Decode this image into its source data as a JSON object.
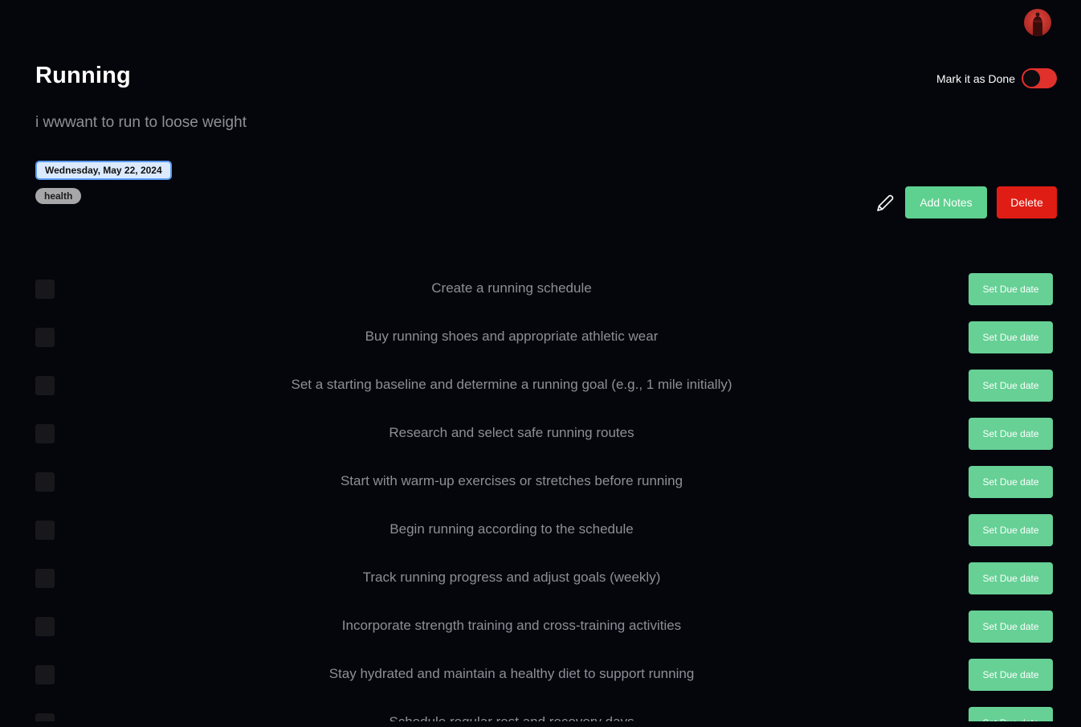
{
  "header": {
    "avatar_icon": "user-avatar-icon"
  },
  "goal": {
    "title": "Running",
    "description": "i wwwant to run to loose weight",
    "date": "Wednesday, May 22, 2024",
    "tag": "health",
    "done_label": "Mark it as Done",
    "done": false
  },
  "actions": {
    "edit_icon": "pencil-icon",
    "add_notes_label": "Add Notes",
    "delete_label": "Delete"
  },
  "tasks": [
    {
      "text": "Create a running schedule",
      "due_label": "Set Due date",
      "done": false
    },
    {
      "text": "Buy running shoes and appropriate athletic wear",
      "due_label": "Set Due date",
      "done": false
    },
    {
      "text": "Set a starting baseline and determine a running goal (e.g., 1 mile initially)",
      "due_label": "Set Due date",
      "done": false
    },
    {
      "text": "Research and select safe running routes",
      "due_label": "Set Due date",
      "done": false
    },
    {
      "text": "Start with warm-up exercises or stretches before running",
      "due_label": "Set Due date",
      "done": false
    },
    {
      "text": "Begin running according to the schedule",
      "due_label": "Set Due date",
      "done": false
    },
    {
      "text": "Track running progress and adjust goals (weekly)",
      "due_label": "Set Due date",
      "done": false
    },
    {
      "text": "Incorporate strength training and cross-training activities",
      "due_label": "Set Due date",
      "done": false
    },
    {
      "text": "Stay hydrated and maintain a healthy diet to support running",
      "due_label": "Set Due date",
      "done": false
    },
    {
      "text": "Schedule regular rest and recovery days",
      "due_label": "Set Due date",
      "done": false
    }
  ],
  "colors": {
    "background": "#05050c",
    "accent_green": "#5ed08f",
    "danger_red": "#e01d14",
    "toggle_red": "#e0312c"
  }
}
